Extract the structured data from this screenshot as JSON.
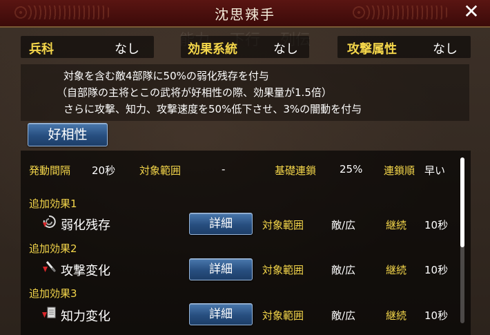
{
  "title": "沈思辣手",
  "attributes": [
    {
      "key": "兵科",
      "value": "なし"
    },
    {
      "key": "効果系統",
      "value": "なし"
    },
    {
      "key": "攻撃属性",
      "value": "なし"
    }
  ],
  "description": [
    "対象を含む敵4部隊に50%の弱化残存を付与",
    "（自部隊の主将とこの武将が好相性の際、効果量が1.5倍）",
    "さらに攻撃、知力、攻撃速度を50%低下させ、3%の闇動を付与"
  ],
  "affinity_button": "好相性",
  "stats": {
    "interval_label": "発動間隔",
    "interval_value": "20秒",
    "range_label": "対象範囲",
    "range_value": "-",
    "chain_label": "基礎連鎖",
    "chain_value": "25%",
    "order_label": "連鎖順",
    "order_value": "早い"
  },
  "effects": [
    {
      "header": "追加効果1",
      "name": "弱化残存",
      "icon": "debuff-swirl-icon",
      "detail": "詳細",
      "range_label": "対象範囲",
      "range_value": "敵/広",
      "duration_label": "継続",
      "duration_value": "10秒"
    },
    {
      "header": "追加効果2",
      "name": "攻撃変化",
      "icon": "attack-down-icon",
      "detail": "詳細",
      "range_label": "対象範囲",
      "range_value": "敵/広",
      "duration_label": "継続",
      "duration_value": "10秒"
    },
    {
      "header": "追加効果3",
      "name": "知力変化",
      "icon": "intellect-down-icon",
      "detail": "詳細",
      "range_label": "対象範囲",
      "range_value": "敵/広",
      "duration_label": "継続",
      "duration_value": "10秒"
    }
  ],
  "colors": {
    "accent_yellow": "#f4d64a",
    "title_bar": "#5a1512",
    "button_blue": "#274e7f",
    "debuff_red": "#d8262a"
  }
}
